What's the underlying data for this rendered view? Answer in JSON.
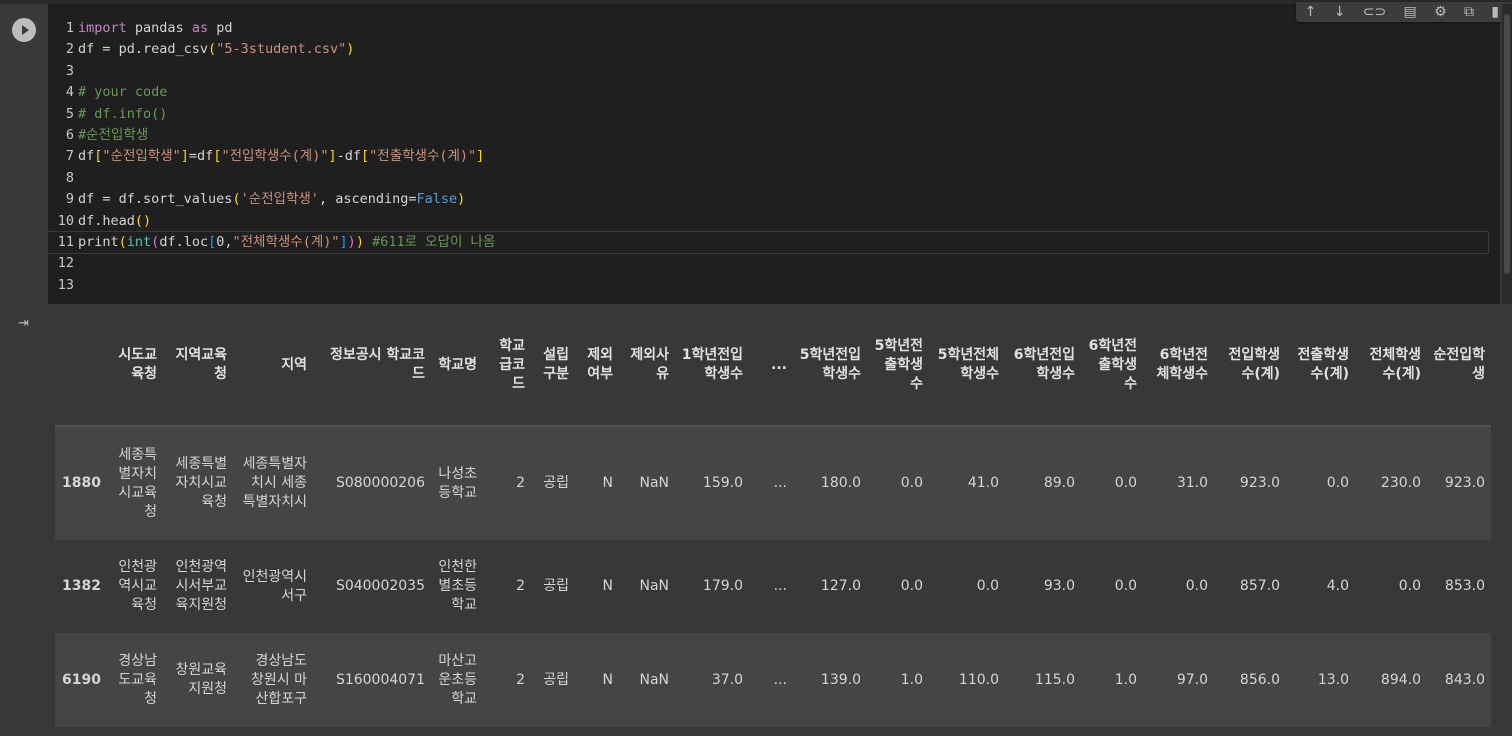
{
  "toolbar": {
    "icons": [
      "arrow-up-icon",
      "arrow-down-icon",
      "link-icon",
      "comment-icon",
      "gear-icon",
      "mirror-cell-icon",
      "trash-icon",
      "more-vert-icon"
    ],
    "glyphs": [
      "↑",
      "↓",
      "⊂⊃",
      "▤",
      "⚙",
      "⧉",
      "▮",
      "⋮"
    ]
  },
  "code": {
    "active_line": 11,
    "lines": [
      [
        [
          "import",
          "kw"
        ],
        [
          " pandas ",
          "p"
        ],
        [
          "as",
          "kw"
        ],
        [
          " pd",
          "p"
        ]
      ],
      [
        [
          "df = pd.read_csv",
          "p"
        ],
        [
          "(",
          "br1"
        ],
        [
          "\"5-3student.csv\"",
          "str"
        ],
        [
          ")",
          "br1"
        ]
      ],
      [],
      [
        [
          "# your code",
          "cm"
        ]
      ],
      [
        [
          "# df.info()",
          "cm"
        ]
      ],
      [
        [
          "#순전입학생",
          "cm"
        ]
      ],
      [
        [
          "df",
          "p"
        ],
        [
          "[",
          "br1"
        ],
        [
          "\"순전입학생\"",
          "str"
        ],
        [
          "]",
          "br1"
        ],
        [
          "=df",
          "p"
        ],
        [
          "[",
          "br1"
        ],
        [
          "\"전입학생수(계)\"",
          "str"
        ],
        [
          "]",
          "br1"
        ],
        [
          "-df",
          "p"
        ],
        [
          "[",
          "br1"
        ],
        [
          "\"전출학생수(계)\"",
          "str"
        ],
        [
          "]",
          "br1"
        ]
      ],
      [],
      [
        [
          "df = df.sort_values",
          "p"
        ],
        [
          "(",
          "br1"
        ],
        [
          "'순전입학생'",
          "str"
        ],
        [
          ", ascending=",
          "p"
        ],
        [
          "False",
          "bool"
        ],
        [
          ")",
          "br1"
        ]
      ],
      [
        [
          "df.head",
          "p"
        ],
        [
          "()",
          "br1"
        ]
      ],
      [
        [
          "print",
          "p"
        ],
        [
          "(",
          "br1"
        ],
        [
          "int",
          "fn"
        ],
        [
          "(",
          "br2"
        ],
        [
          "df.loc",
          "p"
        ],
        [
          "[",
          "br3"
        ],
        [
          "0,",
          "p"
        ],
        [
          "\"전체학생수(계)\"",
          "str"
        ],
        [
          "]",
          "br3"
        ],
        [
          ")",
          "br2"
        ],
        [
          ")",
          "br1"
        ],
        [
          " #611로 오답이 나옴",
          "cm"
        ]
      ],
      [],
      []
    ]
  },
  "output": {
    "columns": [
      "",
      "시도교육청",
      "지역교육청",
      "지역",
      "정보공시 학교코드",
      "학교명",
      "학교급코드",
      "설립구분",
      "제외여부",
      "제외사유",
      "1학년전입학생수",
      "...",
      "5학년전입학생수",
      "5학년전출학생수",
      "5학년전체학생수",
      "6학년전입학생수",
      "6학년전출학생수",
      "6학년전체학생수",
      "전입학생수(계)",
      "전출학생수(계)",
      "전체학생수(계)",
      "순전입학생"
    ],
    "rows": [
      [
        "1880",
        "세종특별자치시교육청",
        "세종특별자치시교육청",
        "세종특별자치시 세종특별자치시",
        "S080000206",
        "나성초등학교",
        "2",
        "공립",
        "N",
        "NaN",
        "159.0",
        "...",
        "180.0",
        "0.0",
        "41.0",
        "89.0",
        "0.0",
        "31.0",
        "923.0",
        "0.0",
        "230.0",
        "923.0"
      ],
      [
        "1382",
        "인천광역시교육청",
        "인천광역시서부교육지원청",
        "인천광역시 서구",
        "S040002035",
        "인천한별초등학교",
        "2",
        "공립",
        "N",
        "NaN",
        "179.0",
        "...",
        "127.0",
        "0.0",
        "0.0",
        "93.0",
        "0.0",
        "0.0",
        "857.0",
        "4.0",
        "0.0",
        "853.0"
      ],
      [
        "6190",
        "경상남도교육청",
        "창원교육지원청",
        "경상남도 창원시 마산합포구",
        "S160004071",
        "마산고운초등학교",
        "2",
        "공립",
        "N",
        "NaN",
        "37.0",
        "...",
        "139.0",
        "1.0",
        "110.0",
        "115.0",
        "1.0",
        "97.0",
        "856.0",
        "13.0",
        "894.0",
        "843.0"
      ]
    ]
  }
}
